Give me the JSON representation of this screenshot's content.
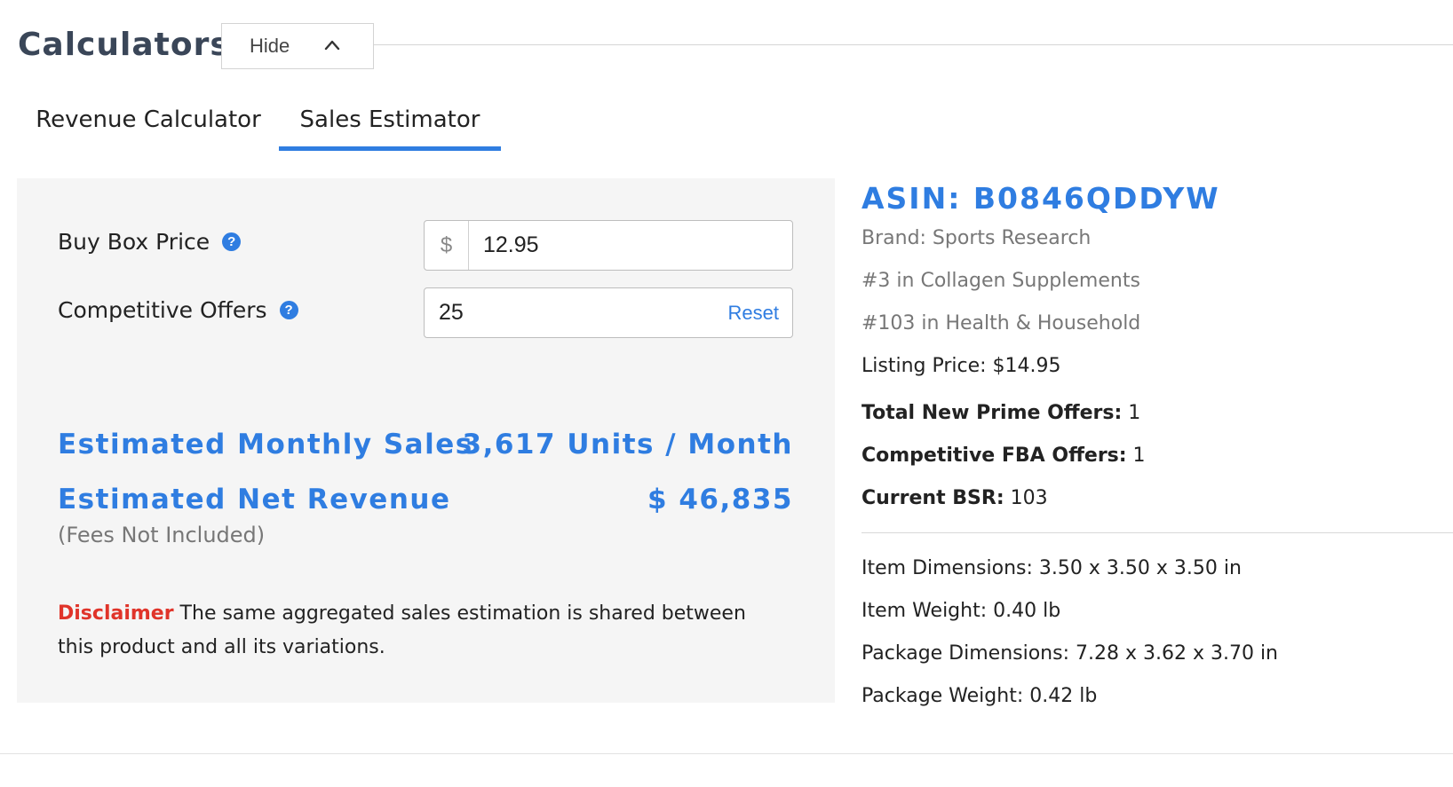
{
  "header": {
    "title": "Calculators",
    "hide_label": "Hide"
  },
  "tabs": [
    {
      "label": "Revenue Calculator",
      "active": false
    },
    {
      "label": "Sales Estimator",
      "active": true
    }
  ],
  "form": {
    "buy_box_label": "Buy Box Price",
    "buy_box_prefix": "$",
    "buy_box_value": "12.95",
    "offers_label": "Competitive Offers",
    "offers_value": "25",
    "reset_label": "Reset",
    "help_glyph": "?"
  },
  "results": {
    "monthly_sales_label": "Estimated Monthly Sales",
    "monthly_sales_value": "3,617 Units / Month",
    "net_revenue_label": "Estimated Net Revenue",
    "net_revenue_value": "$ 46,835",
    "fees_note": "(Fees Not Included)"
  },
  "disclaimer": {
    "label": "Disclaimer",
    "text": " The same aggregated sales estimation is shared between this product and all its variations."
  },
  "product": {
    "asin": "ASIN: B0846QDDYW",
    "brand": "Brand: Sports Research",
    "rank_category": "#3 in Collagen Supplements",
    "rank_main": "#103 in Health & Household",
    "listing_price": "Listing Price: $14.95",
    "prime_offers_label": "Total New Prime Offers:",
    "prime_offers_value": " 1",
    "fba_offers_label": "Competitive FBA Offers:",
    "fba_offers_value": " 1",
    "bsr_label": "Current BSR:",
    "bsr_value": " 103",
    "item_dimensions": "Item Dimensions: 3.50 x 3.50 x 3.50 in",
    "item_weight": "Item Weight: 0.40 lb",
    "package_dimensions": "Package Dimensions: 7.28 x 3.62 x 3.70 in",
    "package_weight": "Package Weight: 0.42 lb"
  },
  "colors": {
    "accent": "#2f7de1",
    "warning": "#e0342a",
    "panel_bg": "#f5f5f5"
  },
  "icons": [
    "chevron-up-icon",
    "help-icon"
  ]
}
